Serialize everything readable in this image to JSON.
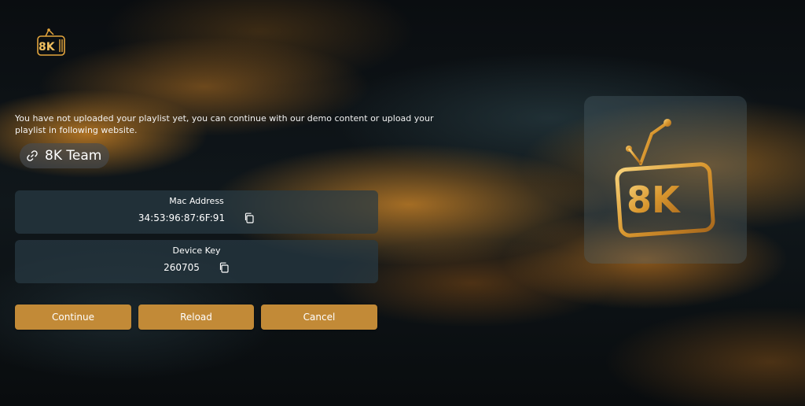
{
  "brand": {
    "logo_text": "8K",
    "accent": "#c28a37",
    "gold": "#e3a53d"
  },
  "message": "You have not uploaded your playlist yet, you can continue with our demo content or upload your playlist in following website.",
  "link": {
    "icon": "link-icon",
    "label": "8K Team"
  },
  "mac": {
    "label": "Mac Address",
    "value": "34:53:96:87:6F:91",
    "icon": "copy-icon"
  },
  "device": {
    "label": "Device Key",
    "value": "260705",
    "icon": "copy-icon"
  },
  "buttons": {
    "continue": "Continue",
    "reload": "Reload",
    "cancel": "Cancel"
  }
}
